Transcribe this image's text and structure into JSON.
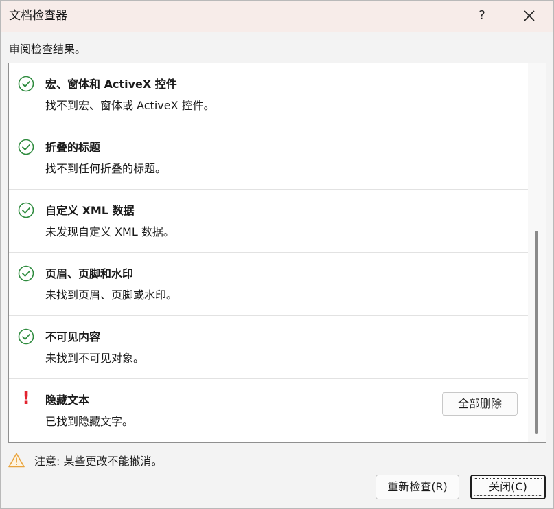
{
  "dialog": {
    "title": "文档检查器",
    "help_label": "?",
    "instructions": "审阅检查结果。"
  },
  "results": [
    {
      "status": "ok",
      "title": "宏、窗体和 ActiveX 控件",
      "description": "找不到宏、窗体或 ActiveX 控件。"
    },
    {
      "status": "ok",
      "title": "折叠的标题",
      "description": "找不到任何折叠的标题。"
    },
    {
      "status": "ok",
      "title": "自定义 XML 数据",
      "description": "未发现自定义 XML 数据。"
    },
    {
      "status": "ok",
      "title": "页眉、页脚和水印",
      "description": "未找到页眉、页脚或水印。"
    },
    {
      "status": "ok",
      "title": "不可见内容",
      "description": "未找到不可见对象。"
    },
    {
      "status": "found",
      "title": "隐藏文本",
      "description": "已找到隐藏文字。",
      "warn_mark": "!",
      "action_label": "全部删除"
    }
  ],
  "footer": {
    "warning_text": "注意: 某些更改不能撤消。",
    "reinspect_label": "重新检查(R)",
    "close_label": "关闭(C)"
  },
  "colors": {
    "ok_green": "#2e8b3e",
    "warn_red": "#e2232f",
    "warn_triangle": "#e8a33d",
    "titlebar_bg": "#f7ece9"
  },
  "icons": {
    "ok": "check-circle-icon",
    "found": "exclamation-icon",
    "footer": "warning-triangle-icon",
    "close": "close-icon"
  }
}
